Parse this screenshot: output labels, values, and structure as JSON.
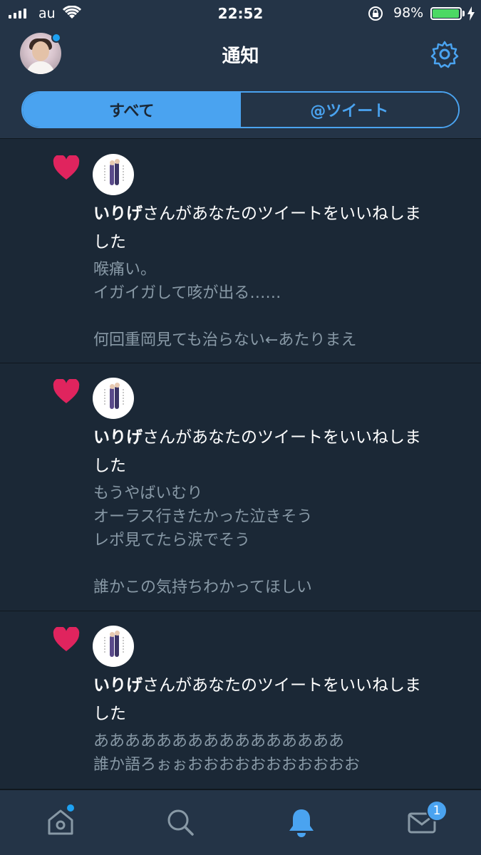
{
  "status": {
    "carrier": "au",
    "time": "22:52",
    "battery_percent": "98%",
    "battery_level": 0.98
  },
  "header": {
    "title": "通知",
    "tabs": [
      {
        "label": "すべて",
        "active": true
      },
      {
        "label": "@ツイート",
        "active": false
      }
    ]
  },
  "notifications": [
    {
      "user": "いりげ",
      "action": "さんがあなたのツイートをいいねしま",
      "action_cont": "した",
      "tweet_lines": [
        "喉痛い。",
        "イガイガして咳が出る……",
        "",
        "何回重岡見ても治らない←あたりまえ"
      ]
    },
    {
      "user": "いりげ",
      "action": "さんがあなたのツイートをいいねしま",
      "action_cont": "した",
      "tweet_lines": [
        "もうやばいむり",
        "オーラス行きたかった泣きそう",
        "レポ見てたら涙でそう",
        "",
        "誰かこの気持ちわかってほしい"
      ]
    },
    {
      "user": "いりげ",
      "action": "さんがあなたのツイートをいいねしま",
      "action_cont": "した",
      "tweet_lines": [
        "ああああああああああああああああ",
        "誰か語ろぉぉおおおおおおおおおおお"
      ]
    }
  ],
  "tabbar": {
    "messages_badge": "1"
  },
  "colors": {
    "background": "#1b2836",
    "bar": "#243447",
    "accent": "#4aa3f0",
    "heart": "#e0245e",
    "muted_text": "#8899a6"
  },
  "icons": [
    "home-icon",
    "search-icon",
    "notifications-bell-icon",
    "messages-envelope-icon",
    "settings-gear-icon",
    "heart-icon"
  ]
}
